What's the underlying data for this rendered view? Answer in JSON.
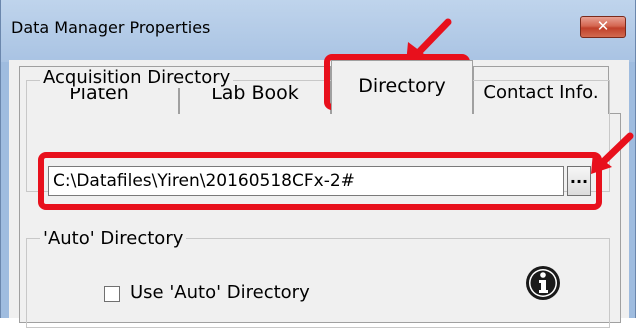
{
  "window": {
    "title": "Data Manager Properties",
    "close_symbol": "✕"
  },
  "tabs": [
    {
      "label": "Platen",
      "active": false
    },
    {
      "label": "Lab Book",
      "active": false
    },
    {
      "label": "Directory",
      "active": true
    },
    {
      "label": "Contact Info.",
      "active": false
    }
  ],
  "acquisition": {
    "group_label": "Acquisition Directory",
    "path_value": "C:\\Datafiles\\Yiren\\20160518CFx-2#",
    "browse_label": "..."
  },
  "auto": {
    "group_label": "'Auto' Directory",
    "checkbox_label": "Use 'Auto' Directory",
    "checked": false,
    "info_icon": "info-icon"
  },
  "annotations": {
    "highlight_color": "#e8101c",
    "arrow_color": "#e8101c"
  }
}
